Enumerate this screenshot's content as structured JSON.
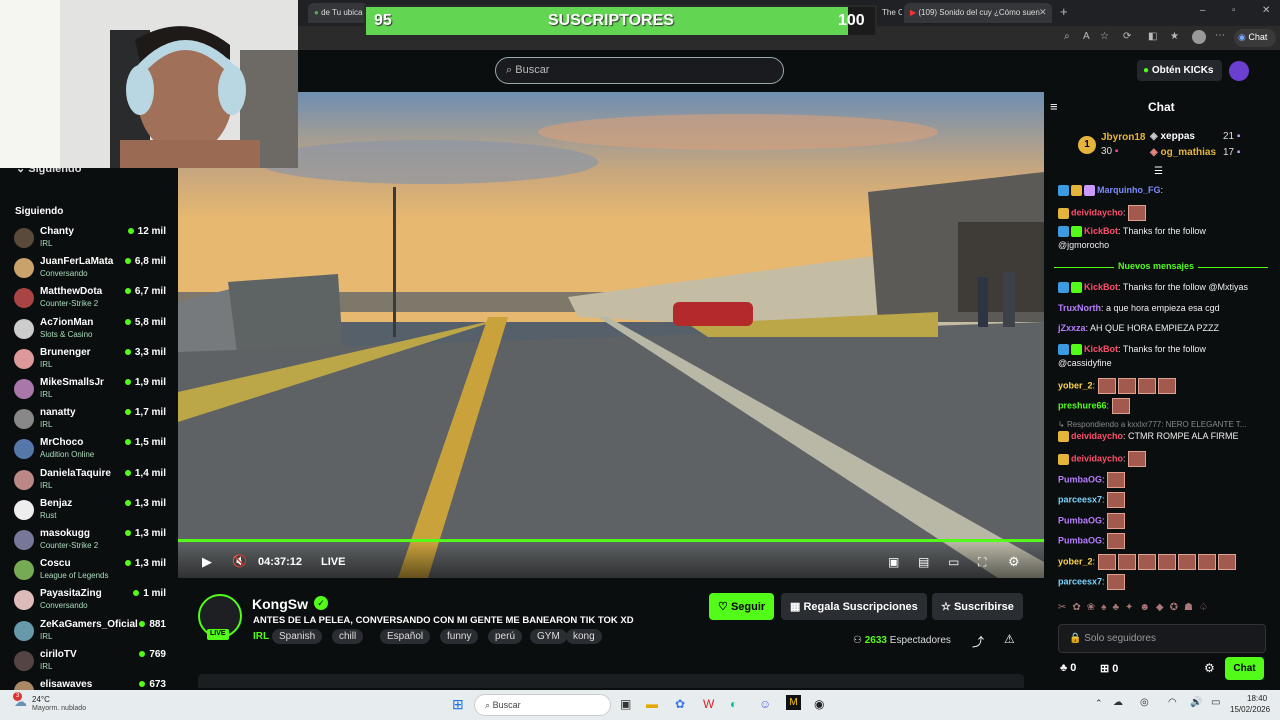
{
  "browser": {
    "tabs": [
      {
        "label": "de Tu ubica"
      },
      {
        "label": "The Champ"
      },
      {
        "label": "(109) Sonido del cuy ¿Cómo suen"
      }
    ],
    "tab_close": "✕",
    "new_tab": "+",
    "copilot_label": "Chat"
  },
  "subscriber_goal": {
    "current": "95",
    "label": "SUSCRIPTORES",
    "target": "100"
  },
  "header": {
    "search_placeholder": "Buscar",
    "kicks_label": "Obtén KICKs"
  },
  "sidebar": {
    "top_label": "Siguiendo",
    "section_title": "Siguiendo",
    "channels": [
      {
        "name": "Chanty",
        "category": "IRL",
        "viewers": "12 mil",
        "color": "#5a4a3a"
      },
      {
        "name": "JuanFerLaMata",
        "category": "Conversando",
        "viewers": "6,8 mil",
        "color": "#c9a26a"
      },
      {
        "name": "MatthewDota",
        "category": "Counter-Strike 2",
        "viewers": "6,7 mil",
        "color": "#a44"
      },
      {
        "name": "Ac7ionMan",
        "category": "Slots & Casino",
        "viewers": "5,8 mil",
        "color": "#ccc"
      },
      {
        "name": "Brunenger",
        "category": "IRL",
        "viewers": "3,3 mil",
        "color": "#d99"
      },
      {
        "name": "MikeSmallsJr",
        "category": "IRL",
        "viewers": "1,9 mil",
        "color": "#a7a"
      },
      {
        "name": "nanatty",
        "category": "IRL",
        "viewers": "1,7 mil",
        "color": "#888"
      },
      {
        "name": "MrChoco",
        "category": "Audition Online",
        "viewers": "1,5 mil",
        "color": "#57a"
      },
      {
        "name": "DanielaTaquire",
        "category": "IRL",
        "viewers": "1,4 mil",
        "color": "#b88"
      },
      {
        "name": "Benjaz",
        "category": "Rust",
        "viewers": "1,3 mil",
        "color": "#eee"
      },
      {
        "name": "masokugg",
        "category": "Counter-Strike 2",
        "viewers": "1,3 mil",
        "color": "#779"
      },
      {
        "name": "Coscu",
        "category": "League of Legends",
        "viewers": "1,3 mil",
        "color": "#7a5"
      },
      {
        "name": "PayasitaZing",
        "category": "Conversando",
        "viewers": "1 mil",
        "color": "#dbb"
      },
      {
        "name": "ZeKaGamers_Oficial",
        "category": "IRL",
        "viewers": "881",
        "color": "#69a"
      },
      {
        "name": "ciriloTV",
        "category": "IRL",
        "viewers": "769",
        "color": "#544"
      },
      {
        "name": "elisawaves",
        "category": "",
        "viewers": "673",
        "color": "#a86"
      }
    ]
  },
  "player": {
    "time": "04:37:12",
    "live_label": "LIVE"
  },
  "stream": {
    "channel": "KongSw",
    "live_badge": "LIVE",
    "title": "ANTES DE LA PELEA, CONVERSANDO CON MI GENTE  ME BANEARON TIK TOK XD",
    "category": "IRL",
    "tags": [
      "Spanish",
      "chill",
      "Español",
      "funny",
      "perú",
      "GYM",
      "kong"
    ],
    "viewers": "2633",
    "viewers_label": "Espectadores",
    "follow": "Seguir",
    "gift": "Regala Suscripciones",
    "subscribe": "Suscribirse"
  },
  "chat": {
    "title": "Chat",
    "leaders": [
      {
        "rank": "1",
        "name": "Jbyron18",
        "count": "30"
      },
      {
        "name": "xeppas",
        "count": "21"
      },
      {
        "name": "og_mathias",
        "count": "17"
      }
    ],
    "new_messages": "Nuevos mensajes",
    "reply_note": "Respondiendo a kxxlxr777: NERO ELEGANTE T...",
    "messages": [
      {
        "user": "Marquinho_FG",
        "text": "",
        "color": "#7b8cff"
      },
      {
        "user": "deividaycho",
        "text": "",
        "color": "#ff4d6d"
      },
      {
        "user": "KickBot",
        "text": "Thanks for the follow",
        "color": "#ff4d6d"
      },
      {
        "user": "",
        "text": "@jgmorocho",
        "color": "#fff"
      },
      {
        "user": "KickBot",
        "text": "Thanks for the follow @Mxtiyas",
        "color": "#ff4d6d"
      },
      {
        "user": "TruxNorth",
        "text": "a que hora empieza esa cgd",
        "color": "#b77dff"
      },
      {
        "user": "jZxxza",
        "text": "AH QUE HORA EMPIEZA PZZZ",
        "color": "#b77dff"
      },
      {
        "user": "KickBot",
        "text": "Thanks for the follow",
        "color": "#ff4d6d"
      },
      {
        "user": "",
        "text": "@cassidyfine",
        "color": "#fff"
      },
      {
        "user": "yober_2",
        "text": "",
        "color": "#ffd24d"
      },
      {
        "user": "preshure66",
        "text": "",
        "color": "#53fc18"
      },
      {
        "user": "deividaycho",
        "text": "CTMR ROMPE ALA FIRME",
        "color": "#ff4d6d"
      },
      {
        "user": "deividaycho",
        "text": "",
        "color": "#ff4d6d"
      },
      {
        "user": "PumbaOG",
        "text": "",
        "color": "#b77dff"
      },
      {
        "user": "parceesx7",
        "text": "",
        "color": "#7bd3ff"
      },
      {
        "user": "PumbaOG",
        "text": "",
        "color": "#b77dff"
      },
      {
        "user": "PumbaOG",
        "text": "",
        "color": "#b77dff"
      },
      {
        "user": "yober_2",
        "text": "",
        "color": "#ffd24d"
      },
      {
        "user": "parceesx7",
        "text": "",
        "color": "#7bd3ff"
      }
    ],
    "input_placeholder": "Solo seguidores",
    "kicks_count": "0",
    "subs_count": "0",
    "send_label": "Chat"
  },
  "taskbar": {
    "weather_temp": "24°C",
    "weather_desc": "Mayorm. nublado",
    "weather_badge": "3",
    "search_label": "Buscar",
    "time": "18:40",
    "date": "15/02/2026"
  }
}
